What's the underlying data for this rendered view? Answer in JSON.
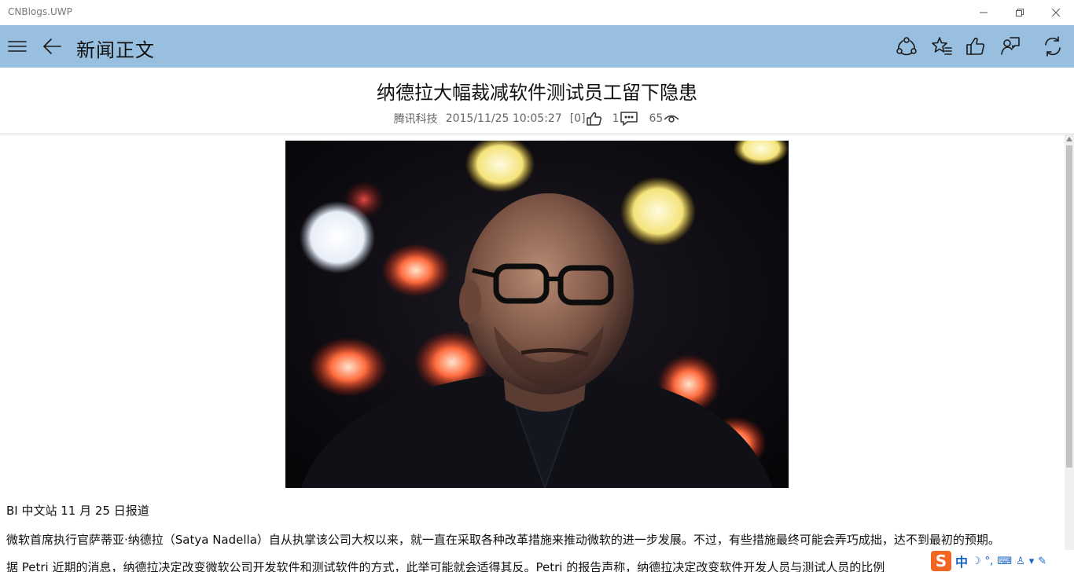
{
  "window": {
    "title": "CNBlogs.UWP"
  },
  "appbar": {
    "page_title": "新闻正文",
    "icons": [
      "menu-icon",
      "back-arrow-icon",
      "share-icon",
      "favorite-icon",
      "like-icon",
      "comment-icon",
      "refresh-icon"
    ]
  },
  "article": {
    "title": "纳德拉大幅裁减软件测试员工留下隐患",
    "source": "腾讯科技",
    "datetime": "2015/11/25 10:05:27",
    "likes": "[0]",
    "comments": "1",
    "views": "65",
    "hero_image": "Photo of Satya Nadella in front of bokeh lights",
    "paragraphs": [
      "BI 中文站 11 月 25 日报道",
      "微软首席执行官萨蒂亚·纳德拉（Satya Nadella）自从执掌该公司大权以来，就一直在采取各种改革措施来推动微软的进一步发展。不过，有些措施最终可能会弄巧成拙，达不到最初的预期。",
      "据 Petri 近期的消息，纳德拉决定改变微软公司开发软件和测试软件的方式，此举可能就会适得其反。Petri 的报告声称，纳德拉决定改变软件开发人员与测试人员的比例"
    ]
  },
  "ime": {
    "mode_label": "中",
    "logo_letter": "S"
  },
  "colors": {
    "appbar_bg": "#98bfe0",
    "ime_orange": "#f26522",
    "ime_blue": "#1565c0"
  }
}
